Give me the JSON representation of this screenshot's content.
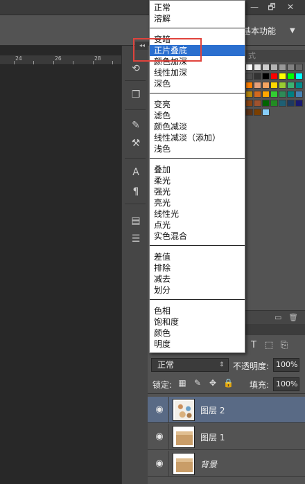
{
  "window": {
    "minimize": "—",
    "restore": "🗗",
    "close": "✕"
  },
  "workspace": {
    "label": "基本功能",
    "arrow": "▼"
  },
  "ruler": {
    "ticks": [
      "24",
      "26",
      "28"
    ]
  },
  "panel_collapse": "◂◂",
  "icon_strip": [
    "history-icon",
    "3d-icon",
    "brush-presets-icon",
    "tool-presets-icon",
    "character-icon",
    "paragraph-icon",
    "notes-icon",
    "properties-icon"
  ],
  "swatches": {
    "header": "式",
    "colors": [
      [
        "#ffffff",
        "#e5e5e5",
        "#cccccc",
        "#b3b3b3",
        "#999999",
        "#808080",
        "#666666"
      ],
      [
        "#4d4d4d",
        "#333333",
        "#000000",
        "#ff0000",
        "#ffff00",
        "#00ff00",
        "#00ffff"
      ],
      [
        "#ff7f00",
        "#e6a07a",
        "#f4a460",
        "#ffd700",
        "#9acd32",
        "#3cb371",
        "#008b8b"
      ],
      [
        "#b8860b",
        "#d2691e",
        "#ffa500",
        "#32cd32",
        "#2e8b57",
        "#008080",
        "#4682b4"
      ],
      [
        "#8b4513",
        "#a0522d",
        "#006400",
        "#228b22",
        "#1e5f74",
        "#1e3a5f",
        "#191970"
      ],
      [
        "#5c3317",
        "#7b3f00",
        "#87cefa"
      ]
    ]
  },
  "layers_panel": {
    "filter_icons": [
      "T",
      "⬚",
      "⎘"
    ],
    "blend_mode": "正常",
    "blend_arrow": "⇕",
    "opacity_label": "不透明度:",
    "opacity_value": "100%",
    "lock_label": "锁定:",
    "fill_label": "填充:",
    "fill_value": "100%",
    "layers": [
      {
        "name": "图层 2",
        "active": true,
        "thumb": "scatter"
      },
      {
        "name": "图层 1",
        "active": false,
        "thumb": "box"
      },
      {
        "name": "背景",
        "active": false,
        "thumb": "box",
        "italic": true
      }
    ]
  },
  "blend_menu": {
    "groups": [
      [
        "正常",
        "溶解"
      ],
      [
        "变暗",
        "正片叠底",
        "颜色加深",
        "线性加深",
        "深色"
      ],
      [
        "变亮",
        "滤色",
        "颜色减淡",
        "线性减淡（添加）",
        "浅色"
      ],
      [
        "叠加",
        "柔光",
        "强光",
        "亮光",
        "线性光",
        "点光",
        "实色混合"
      ],
      [
        "差值",
        "排除",
        "减去",
        "划分"
      ],
      [
        "色相",
        "饱和度",
        "颜色",
        "明度"
      ]
    ],
    "selected": "正片叠底"
  },
  "colors": {
    "selection": "#2b6fcf",
    "annotation": "#e0433c",
    "active_layer": "#596a85"
  }
}
